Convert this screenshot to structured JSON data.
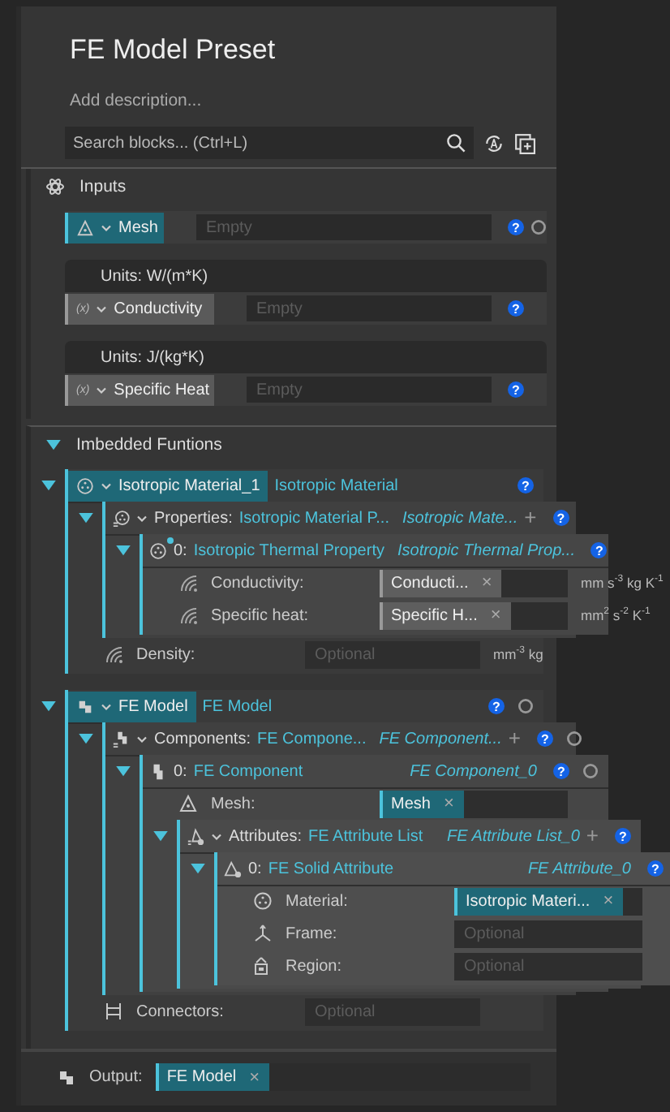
{
  "title": "FE Model Preset",
  "description": "Add description...",
  "search": {
    "placeholder": "Search blocks... (Ctrl+L)"
  },
  "inputs": {
    "title": "Inputs",
    "items": [
      {
        "kind": "mesh",
        "label": "Mesh",
        "placeholder": "Empty",
        "help": "?",
        "status": true
      },
      {
        "kind": "scalar",
        "units": "Units: W/(m*K)",
        "symbol": "(x)",
        "label": "Conductivity",
        "placeholder": "Empty",
        "help": "?",
        "status": false
      },
      {
        "kind": "scalar",
        "units": "Units: J/(kg*K)",
        "symbol": "(x)",
        "label": "Specific Heat",
        "placeholder": "Empty",
        "help": "?",
        "status": false
      }
    ]
  },
  "functions": {
    "title": "Imbedded Funtions",
    "expanded": true,
    "blocks": [
      {
        "kind": "block",
        "dropdown": true,
        "label": "Isotropic Material_1",
        "type": "Isotropic Material",
        "help": "?",
        "expanded": true,
        "children": [
          {
            "kind": "block",
            "dropdown": true,
            "label": "Properties:",
            "type": "Isotropic Material P...",
            "name": "Isotropic Mate...",
            "add": "+",
            "help": "?",
            "expanded": true,
            "children": [
              {
                "kind": "block",
                "dot": true,
                "label": "0:",
                "type": "Isotropic Thermal Property",
                "name": "Isotropic Thermal Prop...",
                "help": "?",
                "expanded": true,
                "children": [
                  {
                    "kind": "field",
                    "label": "Conductivity:",
                    "chip": {
                      "text": "Conducti...",
                      "close": "×",
                      "kind": "input"
                    },
                    "unit": "mm s$^{-3}$ kg K$^{-1}$"
                  },
                  {
                    "kind": "field",
                    "label": "Specific heat:",
                    "chip": {
                      "text": "Specific H...",
                      "close": "×",
                      "kind": "input"
                    },
                    "unit": "mm$^{2}$ s$^{-2}$ K$^{-1}$"
                  }
                ]
              }
            ]
          },
          {
            "kind": "field",
            "label": "Density:",
            "placeholder": "Optional",
            "unit": "mm$^{-3}$ kg"
          }
        ]
      },
      {
        "kind": "block",
        "dropdown": true,
        "label": "FE Model",
        "type": "FE Model",
        "help": "?",
        "status": true,
        "expanded": true,
        "children": [
          {
            "kind": "block",
            "dropdown": true,
            "label": "Components:",
            "type": "FE Compone...",
            "name": "FE Component...",
            "add": "+",
            "help": "?",
            "status": true,
            "expanded": true,
            "children": [
              {
                "kind": "block",
                "label": "0:",
                "type": "FE Component",
                "name": "FE Component_0",
                "help": "?",
                "status": true,
                "expanded": true,
                "children": [
                  {
                    "kind": "field",
                    "label": "Mesh:",
                    "chip": {
                      "text": "Mesh",
                      "close": "×",
                      "kind": "block"
                    }
                  },
                  {
                    "kind": "block",
                    "dropdown": true,
                    "label": "Attributes:",
                    "type": "FE Attribute List",
                    "name": "FE Attribute List_0",
                    "add": "+",
                    "help": "?",
                    "expanded": true,
                    "children": [
                      {
                        "kind": "block",
                        "label": "0:",
                        "type": "FE Solid Attribute",
                        "name": "FE Attribute_0",
                        "help": "?",
                        "expanded": true,
                        "children": [
                          {
                            "kind": "field",
                            "label": "Material:",
                            "chip": {
                              "text": "Isotropic Materi...",
                              "close": "×",
                              "kind": "block"
                            }
                          },
                          {
                            "kind": "field",
                            "label": "Frame:",
                            "placeholder": "Optional"
                          },
                          {
                            "kind": "field",
                            "label": "Region:",
                            "placeholder": "Optional"
                          }
                        ]
                      }
                    ]
                  }
                ]
              }
            ]
          },
          {
            "kind": "field",
            "label": "Connectors:",
            "placeholder": "Optional"
          }
        ]
      }
    ]
  },
  "output": {
    "label": "Output:",
    "chip": {
      "text": "FE Model",
      "close": "×",
      "kind": "block"
    }
  }
}
